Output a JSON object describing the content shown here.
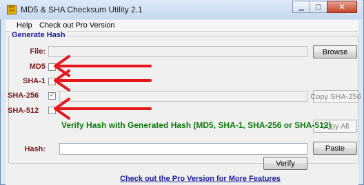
{
  "window": {
    "title": "MD5 & SHA Checksum Utility 2.1",
    "icon_text": "MD5 SHA",
    "minimize_glyph": "▁",
    "maximize_glyph": "▢",
    "close_glyph": "✕"
  },
  "menu": {
    "items": [
      "Help",
      "Check out Pro Version"
    ]
  },
  "generate_hash": {
    "title": "Generate Hash",
    "file_label": "File:",
    "file_value": "",
    "browse_button": "Browse",
    "md5_label": "MD5",
    "md5_checked": false,
    "md5_value": "",
    "sha1_label": "SHA-1",
    "sha1_checked": false,
    "sha1_value": "",
    "sha256_label": "SHA-256",
    "sha256_checked": true,
    "sha256_value": "",
    "copy_sha256_button": "Copy SHA-256",
    "sha512_label": "SHA-512",
    "sha512_checked": false,
    "sha512_value": "",
    "copy_all_button": "Copy All"
  },
  "verify": {
    "title": "Verify Hash with Generated Hash (MD5, SHA-1, SHA-256 or SHA-512)",
    "hash_label": "Hash:",
    "hash_value": "",
    "paste_button": "Paste",
    "verify_button": "Verify"
  },
  "footer": {
    "link_text": "Check out the Pro Version for More Features"
  },
  "annotations": {
    "arrow_color": "#e8161a",
    "arrow_targets": [
      "MD5",
      "SHA-1",
      "SHA-512"
    ]
  }
}
